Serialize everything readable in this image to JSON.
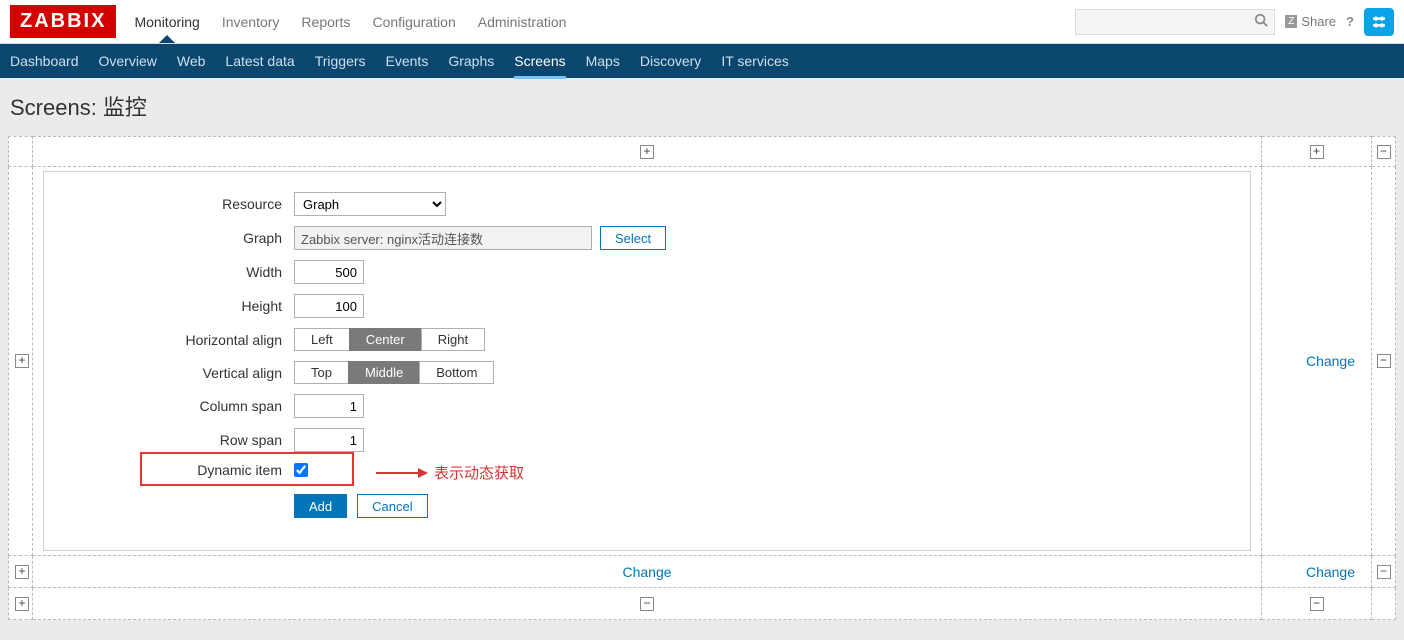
{
  "logo": "ZABBIX",
  "topnav": [
    "Monitoring",
    "Inventory",
    "Reports",
    "Configuration",
    "Administration"
  ],
  "topnav_active": 0,
  "share": "Share",
  "help": "?",
  "subnav": [
    "Dashboard",
    "Overview",
    "Web",
    "Latest data",
    "Triggers",
    "Events",
    "Graphs",
    "Screens",
    "Maps",
    "Discovery",
    "IT services"
  ],
  "subnav_active": 7,
  "page_title": "Screens: 监控",
  "form": {
    "labels": {
      "resource": "Resource",
      "graph": "Graph",
      "width": "Width",
      "height": "Height",
      "halign": "Horizontal align",
      "valign": "Vertical align",
      "colspan": "Column span",
      "rowspan": "Row span",
      "dynamic": "Dynamic item"
    },
    "resource_value": "Graph",
    "graph_value": "Zabbix server: nginx活动连接数",
    "select_btn": "Select",
    "width_value": "500",
    "height_value": "100",
    "halign_options": [
      "Left",
      "Center",
      "Right"
    ],
    "halign_selected": 1,
    "valign_options": [
      "Top",
      "Middle",
      "Bottom"
    ],
    "valign_selected": 1,
    "colspan_value": "1",
    "rowspan_value": "1",
    "dynamic_checked": true,
    "add_btn": "Add",
    "cancel_btn": "Cancel"
  },
  "annotation": "表示动态获取",
  "change_label": "Change"
}
